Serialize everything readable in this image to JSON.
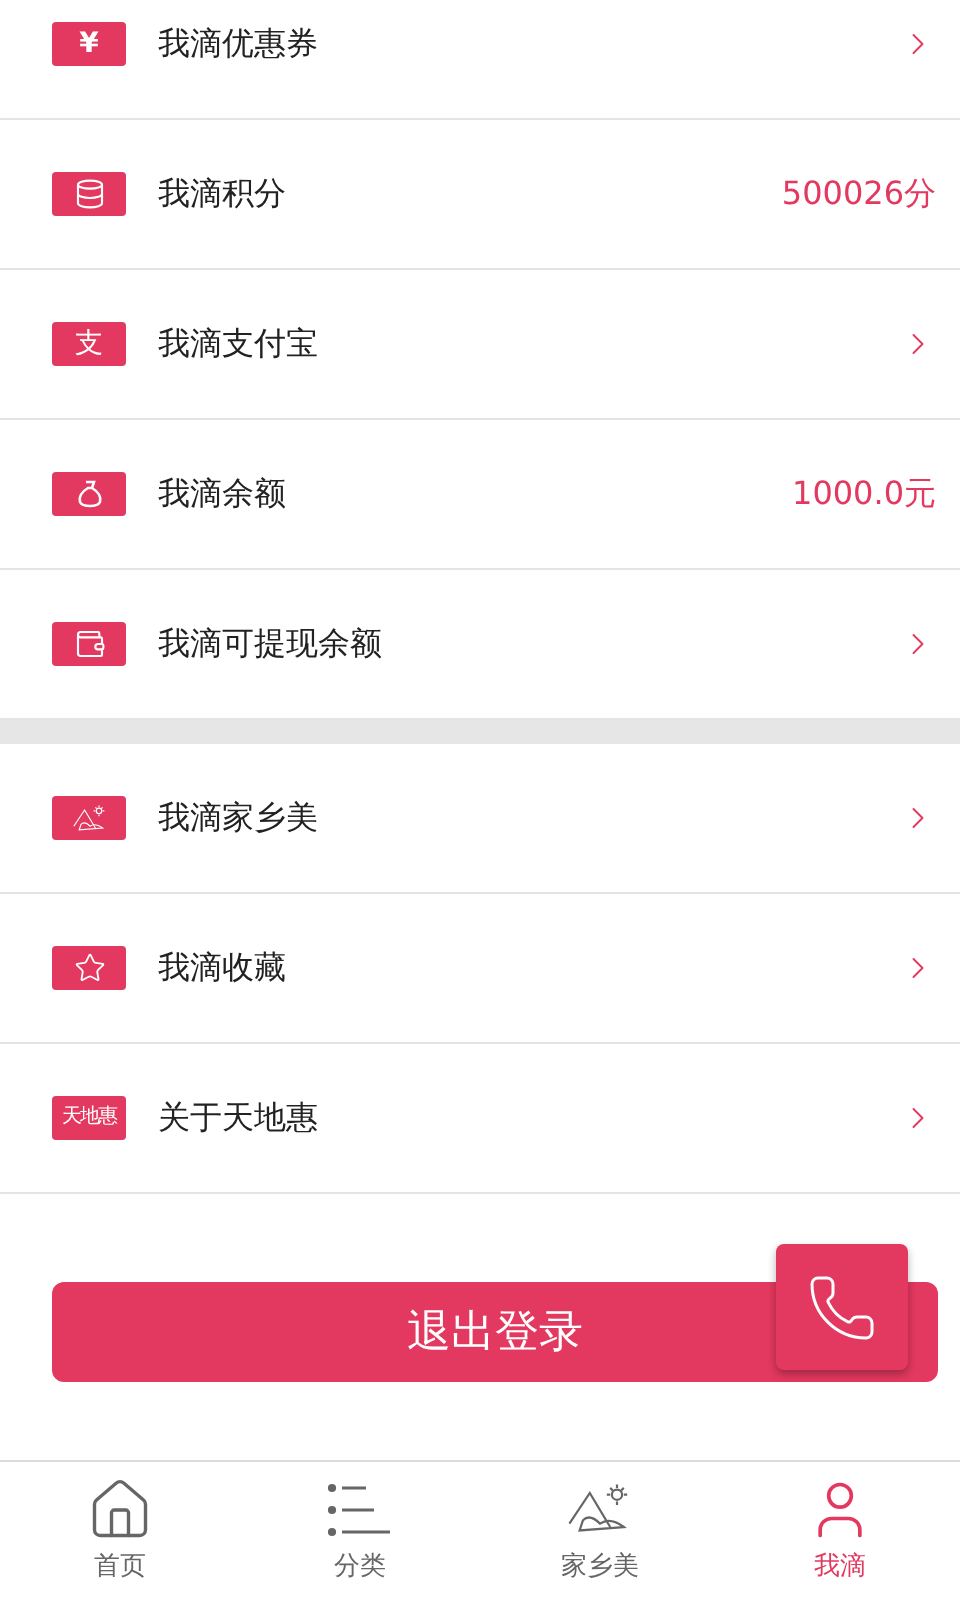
{
  "menu_groups": [
    [
      {
        "kind": "link",
        "badge_text": "¥",
        "label": "我滴优惠券"
      },
      {
        "kind": "value",
        "label": "我滴积分",
        "value": "500026分"
      },
      {
        "kind": "link",
        "badge_text": "支",
        "label": "我滴支付宝"
      },
      {
        "kind": "value",
        "label": "我滴余额",
        "value": "1000.0元"
      },
      {
        "kind": "link",
        "label": "我滴可提现余额"
      }
    ],
    [
      {
        "kind": "link",
        "label": "我滴家乡美"
      },
      {
        "kind": "link",
        "label": "我滴收藏"
      },
      {
        "kind": "link",
        "badge_text": "天地惠",
        "label": "关于天地惠"
      }
    ]
  ],
  "logout_button": "退出登录",
  "tabs": [
    {
      "label": "首页",
      "selected": false
    },
    {
      "label": "分类",
      "selected": false
    },
    {
      "label": "家乡美",
      "selected": false
    },
    {
      "label": "我滴",
      "selected": true
    }
  ]
}
